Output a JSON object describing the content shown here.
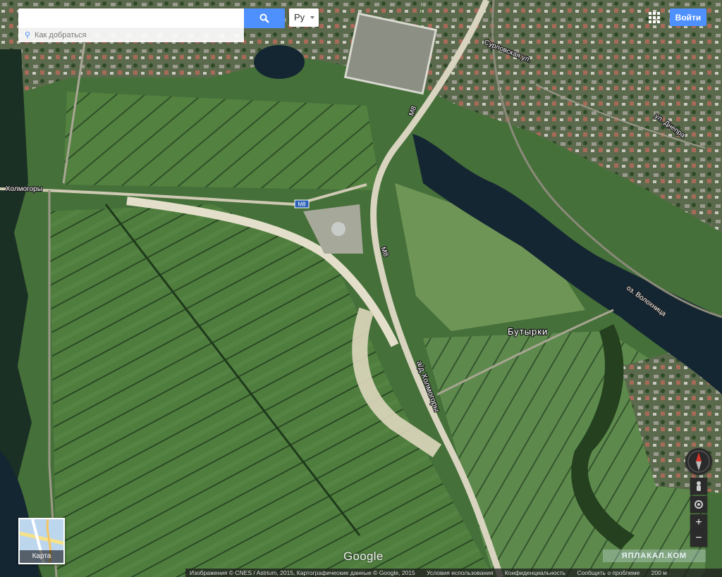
{
  "search": {
    "value": "",
    "placeholder": "",
    "button_icon": "search-icon"
  },
  "directions": {
    "label": "Как добраться",
    "icon": "directions-icon"
  },
  "language": {
    "selected": "Ру"
  },
  "header": {
    "apps_icon": "apps-grid-icon",
    "signin_label": "Войти"
  },
  "map": {
    "labels": {
      "kholmogory_left": "Холмогоры",
      "m8_shield": "М8",
      "m8_north": "М8",
      "m8_mid": "М8",
      "kholmogory_road": "а/д Холмогоры",
      "suvorovskaya": "Сурловская ул.",
      "dnepra": "ул. Днепра",
      "lake": "оз. Волохница",
      "butyrki": "Бутырки"
    },
    "colors": {
      "fields": "#4c7a3c",
      "water": "#142632",
      "road": "#d8d4c0"
    }
  },
  "controls": {
    "compass_icon": "compass-icon",
    "pegman_icon": "pegman-icon",
    "locate_icon": "my-location-icon",
    "zoom_in": "+",
    "zoom_out": "−"
  },
  "minimap": {
    "label": "Карта"
  },
  "branding": {
    "google": "Google",
    "watermark": "ЯПЛАКАЛ.КОМ"
  },
  "footer": {
    "attribution": "Изображения © CNES / Astrium, 2015, Картографические данные © Google, 2015",
    "terms": "Условия использования",
    "privacy": "Конфиденциальность",
    "report": "Сообщить о проблеме",
    "scale": "200 м"
  }
}
